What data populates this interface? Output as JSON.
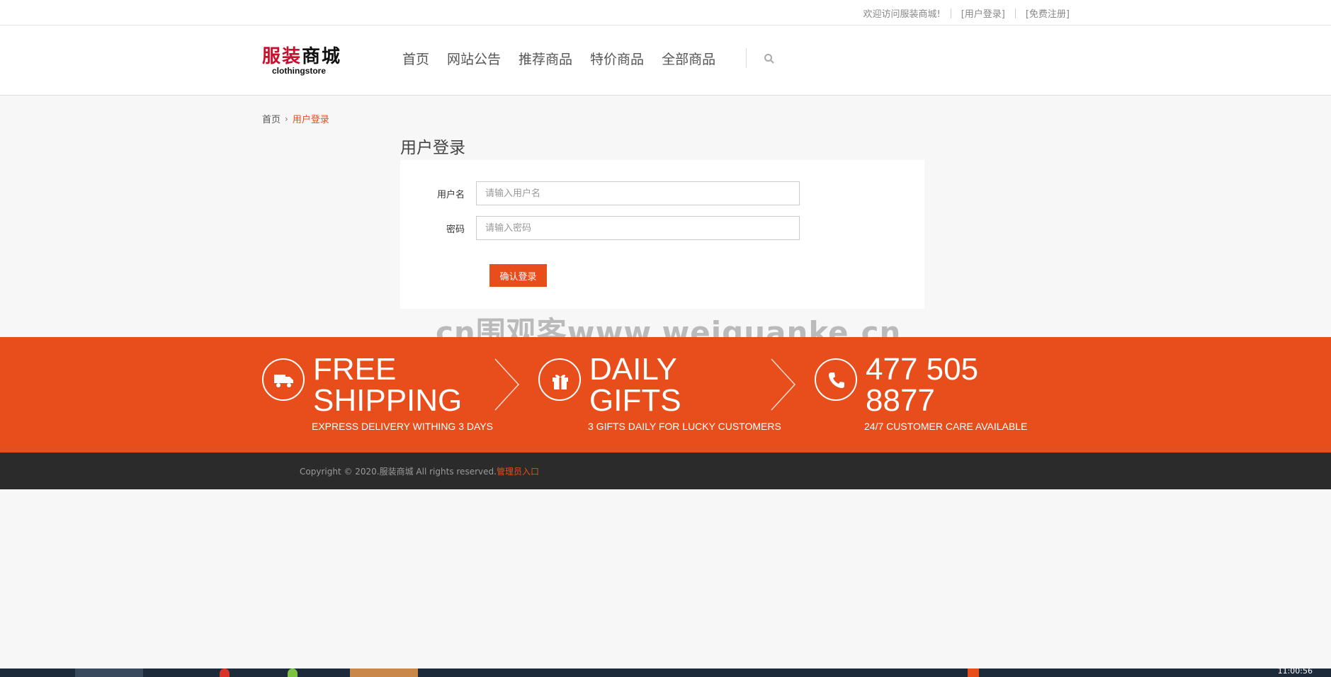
{
  "topbar": {
    "welcome": "欢迎访问服装商城!",
    "login": "[用户登录]",
    "register": "[免费注册]"
  },
  "header": {
    "logo_cn": "服装商城",
    "logo_en": "clothingstore",
    "nav": [
      "首页",
      "网站公告",
      "推荐商品",
      "特价商品",
      "全部商品"
    ]
  },
  "breadcrumb": {
    "home": "首页",
    "arrow": "›",
    "current": "用户登录"
  },
  "login": {
    "title": "用户登录",
    "username_label": "用户名",
    "username_placeholder": "请输入用户名",
    "password_label": "密码",
    "password_placeholder": "请输入密码",
    "submit_label": "确认登录"
  },
  "watermark": "cn围观客www.weiguanke.cn",
  "features": [
    {
      "title_line1": "FREE",
      "title_line2": "SHIPPING",
      "subtitle": "EXPRESS DELIVERY WITHING 3 DAYS",
      "icon": "truck-icon"
    },
    {
      "title_line1": "DAILY",
      "title_line2": "GIFTS",
      "subtitle": "3 GIFTS DAILY FOR LUCKY CUSTOMERS",
      "icon": "gift-icon"
    },
    {
      "title_line1": "477 505",
      "title_line2": "8877",
      "subtitle": "24/7 CUSTOMER CARE AVAILABLE",
      "icon": "phone-icon"
    }
  ],
  "footer": {
    "copyright": "Copyright © 2020.服装商城 All rights reserved.",
    "admin_link": "管理员入口"
  },
  "taskbar": {
    "clock": "11:00:56"
  },
  "colors": {
    "accent": "#e84d1c",
    "footer_bg": "#2b2b2b",
    "page_bg": "#f7f7f7"
  }
}
